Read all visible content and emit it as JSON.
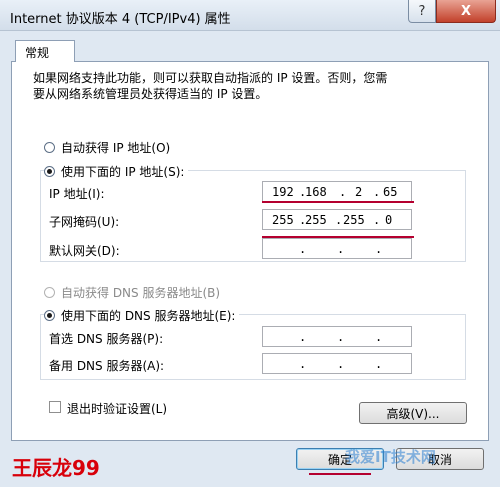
{
  "window": {
    "title": "Internet 协议版本 4 (TCP/IPv4) 属性",
    "help_label": "?",
    "close_label": "X"
  },
  "tab": {
    "label": "常规"
  },
  "description": {
    "line1": "如果网络支持此功能，则可以获取自动指派的 IP 设置。否则，您需",
    "line2": "要从网络系统管理员处获得适当的 IP 设置。"
  },
  "ip_mode": {
    "auto_label": "自动获得 IP 地址(O)",
    "manual_label": "使用下面的 IP 地址(S):",
    "selected": "manual"
  },
  "ip_fields": {
    "ip": {
      "label": "IP 地址(I):",
      "octets": [
        "192",
        "168",
        "2",
        "65"
      ]
    },
    "subnet": {
      "label": "子网掩码(U):",
      "octets": [
        "255",
        "255",
        "255",
        "0"
      ]
    },
    "gateway": {
      "label": "默认网关(D):",
      "octets": [
        "",
        "",
        "",
        ""
      ]
    }
  },
  "dns_mode": {
    "auto_label": "自动获得 DNS 服务器地址(B)",
    "manual_label": "使用下面的 DNS 服务器地址(E):",
    "selected": "manual"
  },
  "dns_fields": {
    "preferred": {
      "label": "首选 DNS 服务器(P):",
      "octets": [
        "",
        "",
        "",
        ""
      ]
    },
    "alternate": {
      "label": "备用 DNS 服务器(A):",
      "octets": [
        "",
        "",
        "",
        ""
      ]
    }
  },
  "validate_on_exit": {
    "label": "退出时验证设置(L)",
    "checked": false
  },
  "buttons": {
    "advanced": "高级(V)...",
    "ok": "确定",
    "cancel": "取消"
  },
  "watermark": {
    "author": "王辰龙99",
    "logo": "我爱IT技术网"
  }
}
